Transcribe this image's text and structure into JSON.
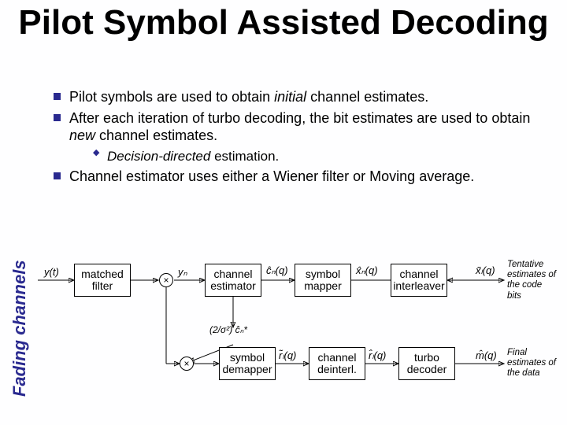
{
  "sidebar": {
    "label": "Fading channels"
  },
  "title": "Pilot Symbol Assisted Decoding",
  "bullets": {
    "b1_a": "Pilot symbols are used to obtain ",
    "b1_em": "initial",
    "b1_b": " channel estimates.",
    "b2_a": "After each iteration of turbo decoding, the bit estimates are used to obtain ",
    "b2_em": "new",
    "b2_b": " channel estimates.",
    "b2_sub_em": "Decision-directed",
    "b2_sub_b": " estimation.",
    "b3": "Channel estimator uses either a Wiener filter or Moving average."
  },
  "diagram": {
    "blocks": {
      "matched_filter": "matched\nfilter",
      "channel_estimator": "channel\nestimator",
      "symbol_mapper": "symbol\nmapper",
      "channel_interleaver": "channel\ninterleaver",
      "symbol_demapper": "symbol\ndemapper",
      "channel_deinterl": "channel\ndeinterl.",
      "turbo_decoder": "turbo\ndecoder"
    },
    "mult_glyph": "×",
    "signals": {
      "y_t": "y(t)",
      "y_n": "yₙ",
      "c_hat": "ĉₙ(q)",
      "x_hat_top": "x̂ₙ(q)",
      "x_tilde": "x̃ₗ(q)",
      "conj_scale": "(2/σ²) ĉₙ*",
      "r_tilde": "r̃ₗ(q)",
      "r_hat": "r̂ₗ(q)",
      "m_hat": "m̂(q)"
    },
    "captions": {
      "top_right": "Tentative estimates of the code bits",
      "bottom_right": "Final estimates of the data"
    }
  }
}
